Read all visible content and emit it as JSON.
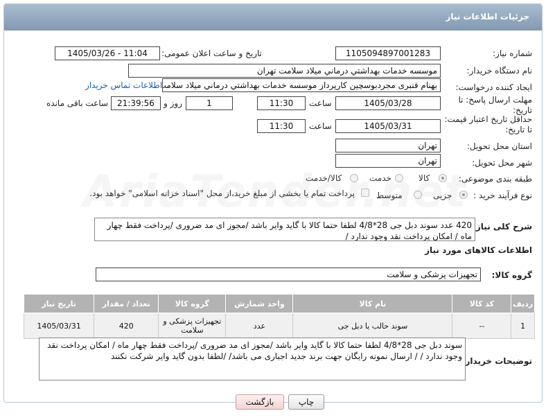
{
  "header": {
    "title": "جزئیات اطلاعات نیاز"
  },
  "watermark": "AriaTender.net",
  "fields": {
    "need_number_label": "شماره نیاز:",
    "need_number": "1105094897001283",
    "announce_label": "تاریخ و ساعت اعلان عمومی:",
    "announce_value": "1405/03/26 - 11:04",
    "buyer_org_label": "نام دستگاه خریدار:",
    "buyer_org": "موسسه خدمات بهداشتي درماني ميلاد سلامت تهران",
    "requester_label": "ایجاد کننده درخواست:",
    "requester": "بهنام قنبری مجردبوسچین کارپرداز موسسه خدمات بهداشتي درماني ميلاد سلامت تهران",
    "contact_link": "اطلاعات تماس خریدار",
    "deadline_label": "مهلت ارسال پاسخ: تا تاریخ:",
    "deadline_date": "1405/03/28",
    "time_label": "ساعت",
    "deadline_time": "11:30",
    "days_value": "1",
    "days_label": "روز و",
    "remaining_time": "21:39:56",
    "remaining_label": "ساعت باقی مانده",
    "validity_label": "حداقل تاریخ اعتبار قیمت: تا تاریخ:",
    "validity_date": "1405/03/31",
    "validity_time": "11:30",
    "province_label": "استان محل تحویل:",
    "province": "تهران",
    "city_label": "شهر محل تحویل:",
    "city": "تهران",
    "category_label": "طبقه بندی موضوعی:",
    "category_options": [
      "کالا",
      "خدمت",
      "کالا/خدمت"
    ],
    "process_label": "نوع فرآیند خرید :",
    "process_options": [
      "جزیی",
      "متوسط"
    ],
    "treasury_note": "پرداخت تمام یا بخشی از مبلغ خرید،از محل \"اسناد خزانه اسلامی\" خواهد بود.",
    "summary_label": "شرح کلی نیاز:",
    "summary": "420 عدد سوند دبل جی  28*4/8 لطفا حتما کالا با گاید وایر باشد /مجوز ای مد ضروری /پرداخت فقط  چهار  ماه / امکان پرداخت نقد وجود ندارد /",
    "goods_info_title": "اطلاعات کالاهای مورد نیاز",
    "goods_group_label": "گروه کالا:",
    "goods_group": "تجهیزات پزشکی و سلامت",
    "buyer_notes_label": "توضیحات خریدار:",
    "buyer_notes": "سوند دبل جی  28*4/8 لطفا حتما کالا با گاید وایر باشد /مجوز ای مد ضروری /پرداخت فقط  چهار  ماه / امکان پرداخت نقد وجود ندارد /  / ارسال نمونه رایگان جهت برند جدید اجباری می باشد/  /لطفا بدون گاید وایر شرکت نکنند"
  },
  "table": {
    "headers": [
      "ردیف",
      "کد کالا",
      "نام کالا",
      "واحد شمارش",
      "گروه کالا",
      "تعداد / مقدار",
      "تاریخ نیاز"
    ],
    "rows": [
      [
        "1",
        "--",
        "سوند حالب یا دبل جی",
        "عدد",
        "تجهیزات پزشکی و سلامت",
        "420",
        "1405/03/31"
      ]
    ]
  },
  "buttons": {
    "print": "چاپ",
    "back": "بازگشت"
  }
}
